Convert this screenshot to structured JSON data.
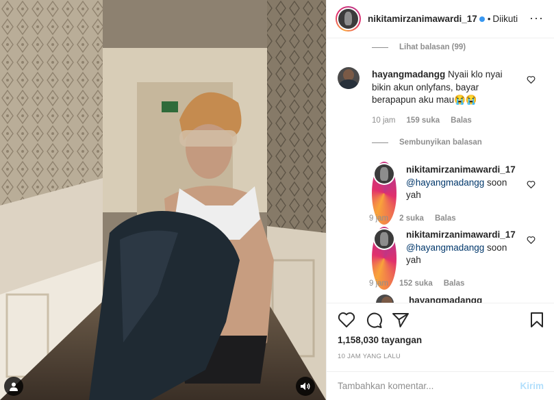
{
  "post": {
    "username": "nikitamirzanimawardi_17",
    "separator": "•",
    "follow_status": "Diikuti"
  },
  "comments": {
    "view_replies_top": "Lihat balasan (99)",
    "hide_replies": "Sembunyikan balasan",
    "main": {
      "user": "hayangmadangg",
      "text": "Nyaii klo nyai bikin akun onlyfans, bayar berapapun aku mau😭😭",
      "time": "10 jam",
      "likes": "159 suka",
      "reply": "Balas"
    },
    "replies": [
      {
        "user": "nikitamirzanimawardi_17",
        "mention": "@hayangmadangg",
        "text": " soon yah",
        "time": "9 jam",
        "likes": "2 suka",
        "reply": "Balas"
      },
      {
        "user": "nikitamirzanimawardi_17",
        "mention": "@hayangmadangg",
        "text": " soon yah",
        "time": "9 jam",
        "likes": "152 suka",
        "reply": "Balas"
      }
    ],
    "partial_user": "hayangmadangg"
  },
  "stats": {
    "views": "1,158,030 tayangan",
    "posted": "10 JAM YANG LALU"
  },
  "composer": {
    "placeholder": "Tambahkan komentar...",
    "post_label": "Kirim"
  },
  "icons": {
    "like": "heart-icon",
    "comment": "comment-icon",
    "share": "share-icon",
    "save": "bookmark-icon",
    "more": "more-icon",
    "tag": "user-tag-icon",
    "mute": "speaker-icon"
  },
  "colors": {
    "link": "#00376b",
    "muted": "#8e8e8e",
    "post_button": "#b2dffc",
    "verified": "#3897f0"
  }
}
